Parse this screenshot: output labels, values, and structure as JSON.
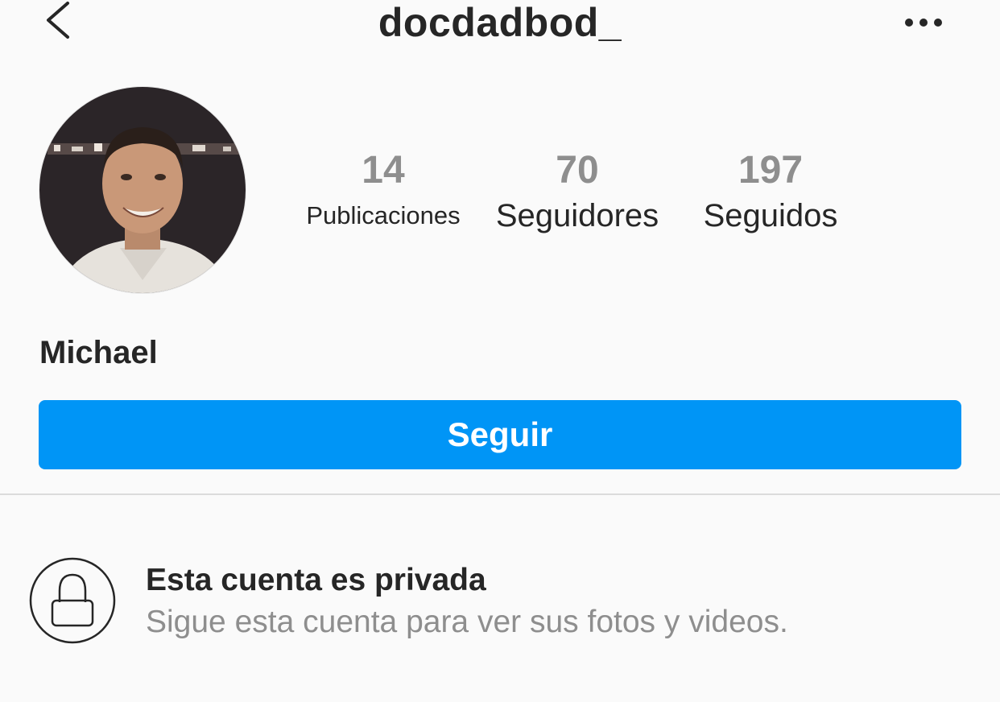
{
  "header": {
    "back_icon": "chevron-left-icon",
    "username": "docdadbod_",
    "more_icon": "more-horizontal-icon"
  },
  "profile": {
    "avatar_alt": "profile-photo",
    "display_name": "Michael",
    "stats": {
      "posts_count": "14",
      "posts_label": "Publicaciones",
      "followers_count": "70",
      "followers_label": "Seguidores",
      "following_count": "197",
      "following_label": "Seguidos"
    }
  },
  "actions": {
    "follow_label": "Seguir"
  },
  "private_notice": {
    "icon": "lock-icon",
    "title": "Esta cuenta es privada",
    "subtitle": "Sigue esta cuenta para ver sus fotos y videos."
  },
  "colors": {
    "background": "#fafafa",
    "primary_blue": "#0095f6",
    "text_primary": "#262626",
    "text_secondary": "#8e8e8e",
    "divider": "#dbdbdb"
  }
}
